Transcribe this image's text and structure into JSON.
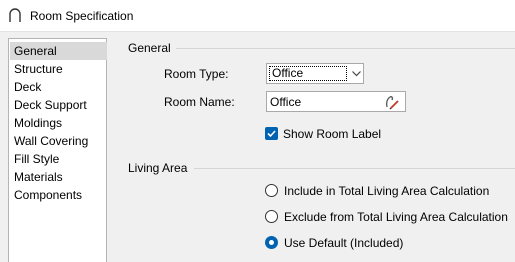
{
  "window": {
    "title": "Room Specification",
    "icon": "arch-room-icon"
  },
  "nav": {
    "items": [
      {
        "label": "General",
        "selected": true
      },
      {
        "label": "Structure"
      },
      {
        "label": "Deck"
      },
      {
        "label": "Deck Support"
      },
      {
        "label": "Moldings"
      },
      {
        "label": "Wall Covering"
      },
      {
        "label": "Fill Style"
      },
      {
        "label": "Materials"
      },
      {
        "label": "Components"
      }
    ]
  },
  "general": {
    "heading": "General",
    "room_type_label": "Room Type:",
    "room_type_value": "Office",
    "room_name_label": "Room Name:",
    "room_name_value": "Office",
    "room_name_icon": "edit-pencil-icon",
    "show_label_checkbox": {
      "label": "Show Room Label",
      "checked": true
    }
  },
  "living_area": {
    "heading": "Living Area",
    "options": [
      {
        "label": "Include in Total Living Area Calculation",
        "checked": false
      },
      {
        "label": "Exclude from Total Living Area Calculation",
        "checked": false
      },
      {
        "label": "Use Default (Included)",
        "checked": true
      }
    ]
  },
  "colors": {
    "accent": "#0063b1",
    "selection": "#d9d9d9"
  }
}
